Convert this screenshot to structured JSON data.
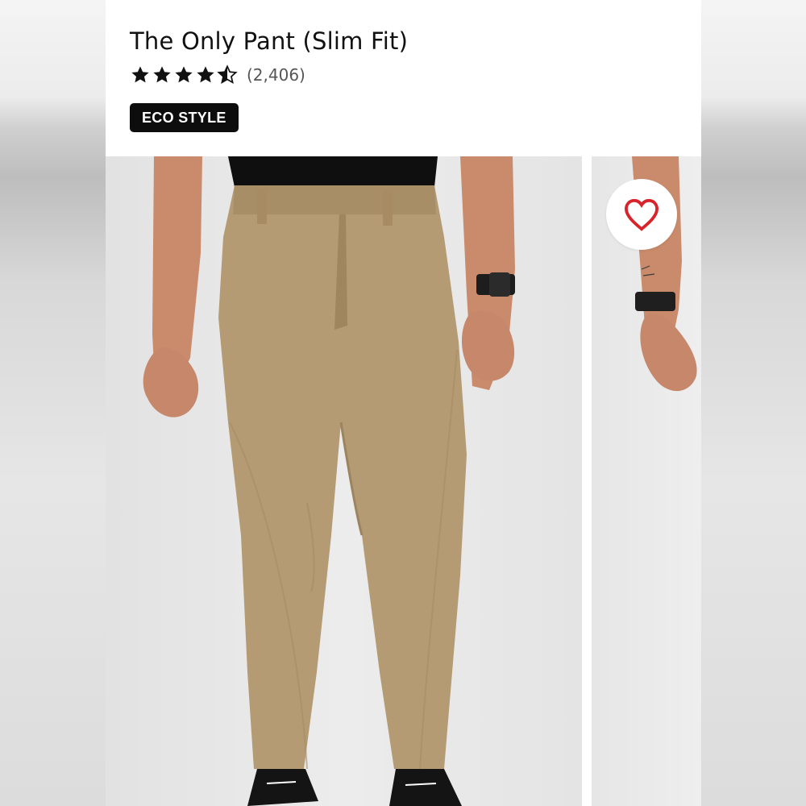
{
  "product": {
    "title": "The Only Pant (Slim Fit)",
    "rating": 4.5,
    "review_count": "(2,406)",
    "badge": "ECO STYLE"
  },
  "images": {
    "main": "model-front-khaki-pants",
    "secondary": "model-side-arm-watch"
  },
  "actions": {
    "favorite_icon": "heart-outline-icon"
  },
  "colors": {
    "star": "#111111",
    "badge_bg": "#0d0d0d",
    "heart": "#d8232a",
    "pant": "#b49b74"
  }
}
